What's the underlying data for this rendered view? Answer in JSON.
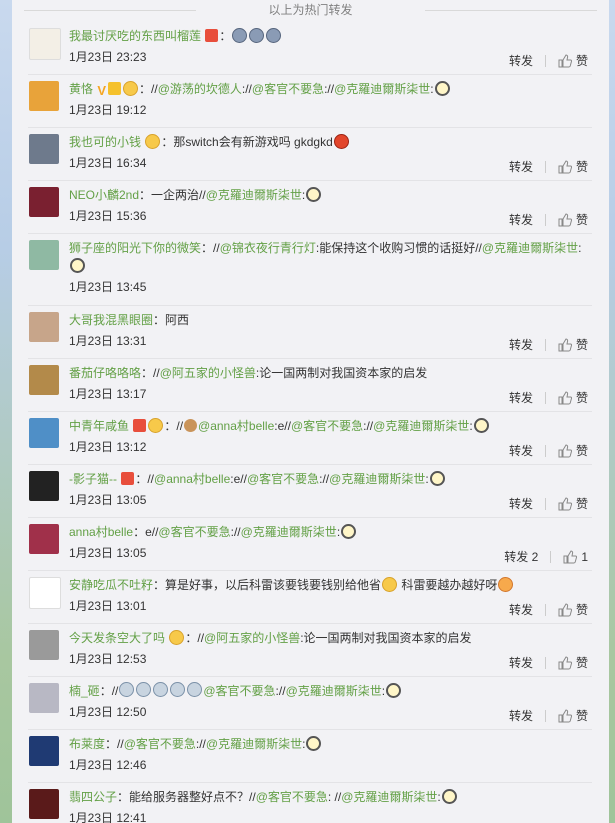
{
  "header": {
    "title": "以上为热门转发"
  },
  "actions": {
    "forward": "转发",
    "like": "赞"
  },
  "comments": [
    {
      "user": "我最讨厌吃的东西叫榴莲",
      "sep": "：",
      "text": "",
      "time": "1月23日 23:23",
      "forward": "转发",
      "like": "赞"
    },
    {
      "user": "黄恪",
      "sep": "：//",
      "link1": "@游荡的坎德人",
      "mid1": "://",
      "link2": "@客官不要急",
      "mid2": "://",
      "link3": "@克羅迪爾斯柒世",
      "mid3": ":",
      "text": "",
      "time": "1月23日 19:12"
    },
    {
      "user": "我也可的小钱",
      "sep": "：",
      "text": "那switch会有新游戏吗 gkdgkd",
      "time": "1月23日 16:34",
      "forward": "转发",
      "like": "赞"
    },
    {
      "user": "NEO小麟2nd",
      "sep": "：",
      "text": "一企两治//",
      "link1": "@克羅迪爾斯柒世",
      "mid1": ":",
      "time": "1月23日 15:36",
      "forward": "转发",
      "like": "赞"
    },
    {
      "user": "狮子座的阳光下你的微笑",
      "sep": "：//",
      "link1": "@锦衣夜行青行灯",
      "text": ":能保持这个收购习惯的话挺好//",
      "link2": "@克羅迪爾斯柒世",
      "mid2": ":",
      "time": "1月23日 13:45"
    },
    {
      "user": "大哥我混黑眼圈",
      "sep": "：",
      "text": "阿西",
      "time": "1月23日 13:31",
      "forward": "转发",
      "like": "赞"
    },
    {
      "user": "番茄仔咯咯咯",
      "sep": "：//",
      "link1": "@阿五家的小怪兽",
      "text": ":论一国两制对我国资本家的启发",
      "time": "1月23日 13:17",
      "forward": "转发",
      "like": "赞"
    },
    {
      "user": "中青年咸鱼",
      "sep": "：//",
      "link1": "@anna村belle",
      "mid1": ":e//",
      "link2": "@客官不要急",
      "mid2": "://",
      "link3": "@克羅迪爾斯柒世",
      "mid3": ":",
      "time": "1月23日 13:12",
      "forward": "转发",
      "like": "赞"
    },
    {
      "user": "-影子猫--",
      "sep": "：//",
      "link1": "@anna村belle",
      "mid1": ":e//",
      "link2": "@客官不要急",
      "mid2": "://",
      "link3": "@克羅迪爾斯柒世",
      "mid3": ":",
      "time": "1月23日 13:05",
      "forward": "转发",
      "like": "赞"
    },
    {
      "user": "anna村belle",
      "sep": "：",
      "text": "e//",
      "link1": "@客官不要急",
      "mid1": "://",
      "link2": "@克羅迪爾斯柒世",
      "mid2": ":",
      "time": "1月23日 13:05",
      "forward": "转发 2",
      "like": "1"
    },
    {
      "user": "安静吃瓜不吐籽",
      "sep": "：",
      "text": "算是好事，以后科雷该要钱要钱别给他省",
      "text2": " 科雷要越办越好呀",
      "time": "1月23日 13:01",
      "forward": "转发",
      "like": "赞"
    },
    {
      "user": "今天发条空大了吗",
      "sep": "：//",
      "link1": "@阿五家的小怪兽",
      "text": ":论一国两制对我国资本家的启发",
      "time": "1月23日 12:53",
      "forward": "转发",
      "like": "赞"
    },
    {
      "user": "楠_砸",
      "sep": "：//",
      "link1": "@客官不要急",
      "mid1": "://",
      "link2": "@克羅迪爾斯柒世",
      "mid2": ":",
      "time": "1月23日 12:50",
      "forward": "转发",
      "like": "赞"
    },
    {
      "user": "布莱度",
      "sep": "：//",
      "link1": "@客官不要急",
      "mid1": "://",
      "link2": "@克羅迪爾斯柒世",
      "mid2": ":",
      "time": "1月23日 12:46"
    },
    {
      "user": "翡四公子",
      "sep": "：",
      "text": "能给服务器整好点不？//",
      "link1": "@客官不要急",
      "mid1": ": //",
      "link2": "@克羅迪爾斯柒世",
      "mid2": ":",
      "time": "1月23日 12:41"
    }
  ],
  "colors": {
    "accent_link": "#63a046",
    "text": "#333333",
    "muted": "#808080",
    "panel": "#f2f2f5"
  },
  "icons": [
    "thumb-up-icon",
    "avatar-image",
    "emoji-icon",
    "vip-icon"
  ]
}
